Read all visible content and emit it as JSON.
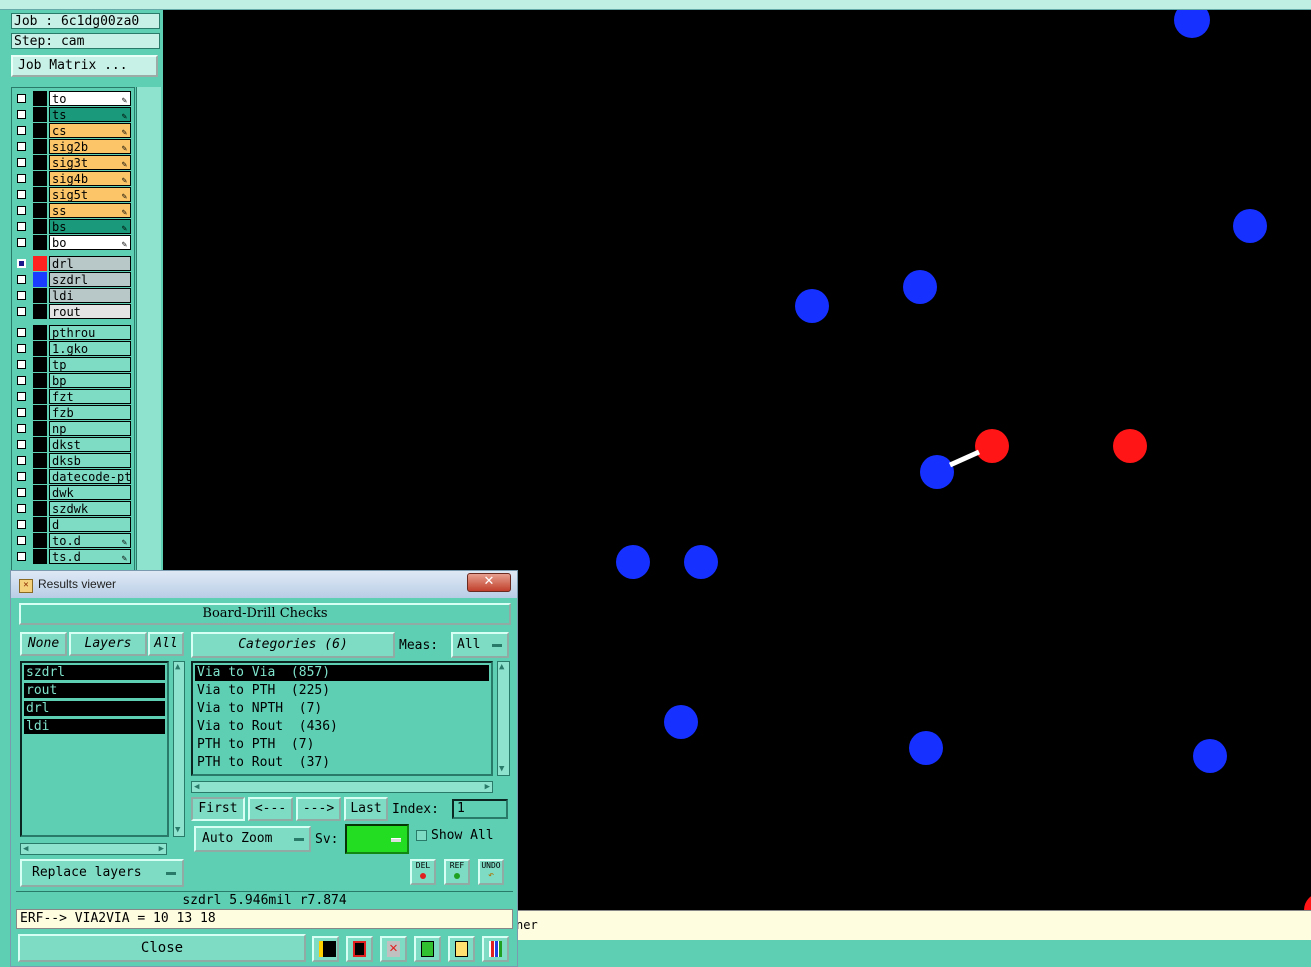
{
  "job": {
    "job_label": "Job : 6c1dg00za0",
    "step_label": "Step: cam",
    "matrix_button": "Job Matrix ..."
  },
  "layers": [
    {
      "name": "to",
      "color": "#ffffff",
      "editable": true
    },
    {
      "name": "ts",
      "color": "#1a9a7a",
      "editable": true
    },
    {
      "name": "cs",
      "color": "#fcc668",
      "editable": true
    },
    {
      "name": "sig2b",
      "color": "#fcc668",
      "editable": true
    },
    {
      "name": "sig3t",
      "color": "#fcc668",
      "editable": true
    },
    {
      "name": "sig4b",
      "color": "#fcc668",
      "editable": true
    },
    {
      "name": "sig5t",
      "color": "#fcc668",
      "editable": true
    },
    {
      "name": "ss",
      "color": "#fcc668",
      "editable": true
    },
    {
      "name": "bs",
      "color": "#1a9a7a",
      "editable": true
    },
    {
      "name": "bo",
      "color": "#ffffff",
      "editable": true
    },
    {
      "name": "drl",
      "color": "#b8c8c8",
      "swatch": "#ff2020",
      "active": true
    },
    {
      "name": "szdrl",
      "color": "#b8c8c8",
      "swatch": "#1a3cff"
    },
    {
      "name": "ldi",
      "color": "#b8c8c8"
    },
    {
      "name": "rout",
      "color": "#e4e4e4"
    },
    {
      "name": "pthrou",
      "color": "#7fdcc4"
    },
    {
      "name": "1.gko",
      "color": "#7fdcc4"
    },
    {
      "name": "tp",
      "color": "#7fdcc4"
    },
    {
      "name": "bp",
      "color": "#7fdcc4"
    },
    {
      "name": "fzt",
      "color": "#7fdcc4"
    },
    {
      "name": "fzb",
      "color": "#7fdcc4"
    },
    {
      "name": "np",
      "color": "#7fdcc4"
    },
    {
      "name": "dkst",
      "color": "#7fdcc4"
    },
    {
      "name": "dksb",
      "color": "#7fdcc4"
    },
    {
      "name": "datecode-pte",
      "color": "#7fdcc4"
    },
    {
      "name": "dwk",
      "color": "#7fdcc4"
    },
    {
      "name": "szdwk",
      "color": "#7fdcc4"
    },
    {
      "name": "d",
      "color": "#7fdcc4"
    },
    {
      "name": "to.d",
      "color": "#7fdcc4",
      "editable": true
    },
    {
      "name": "ts.d",
      "color": "#7fdcc4",
      "editable": true
    }
  ],
  "results_viewer": {
    "window_title": "Results viewer",
    "close_x": "✕",
    "header": "Board-Drill Checks",
    "none_btn": "None",
    "layers_btn": "Layers",
    "all_btn": "All",
    "layer_items": [
      "szdrl",
      "rout",
      "drl",
      "ldi"
    ],
    "categories_btn": "Categories (6)",
    "meas_label": "Meas:",
    "meas_value": "All",
    "categories": [
      "Via to Via  (857)",
      "Via to PTH  (225)",
      "Via to NPTH  (7)",
      "Via to Rout  (436)",
      "PTH to PTH  (7)",
      "PTH to Rout  (37)"
    ],
    "selected_category": 0,
    "nav": {
      "first": "First",
      "prev": "<---",
      "next": "--->",
      "last": "Last",
      "index_label": "Index:",
      "index_value": "1"
    },
    "auto_zoom": "Auto Zoom",
    "sv_label": "Sv:",
    "show_all": "Show All",
    "replace_layers": "Replace layers",
    "del": "DEL",
    "ref": "REF",
    "undo": "UNDO",
    "measure_text": "szdrl  5.946mil  r7.874",
    "erf_text": "ERF--> VIA2VIA = 10 13 18",
    "close": "Close"
  },
  "status_bar": {
    "text": "ner"
  },
  "colors": {
    "panel": "#5fcfb4",
    "canvas": "#000000",
    "via_blue": "#1530ff",
    "via_red": "#ff1515"
  }
}
